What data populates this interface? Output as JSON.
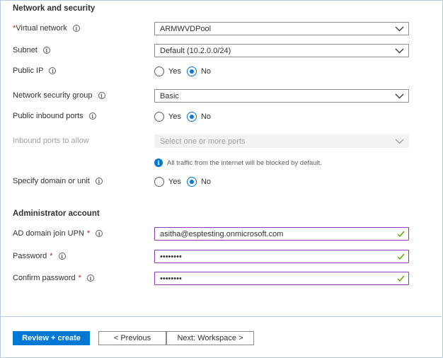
{
  "network_section": {
    "title": "Network and security",
    "virtual_network": {
      "required_mark": "*",
      "label": "Virtual network",
      "value": "ARMWVDPool"
    },
    "subnet": {
      "label": "Subnet",
      "value": "Default (10.2.0.0/24)"
    },
    "public_ip": {
      "label": "Public IP",
      "options": [
        "Yes",
        "No"
      ],
      "selected": "No"
    },
    "nsg": {
      "label": "Network security group",
      "value": "Basic"
    },
    "public_inbound_ports": {
      "label": "Public inbound ports",
      "options": [
        "Yes",
        "No"
      ],
      "selected": "No"
    },
    "inbound_ports": {
      "label": "Inbound ports to allow",
      "placeholder": "Select one or more ports"
    },
    "traffic_note": "All traffic from the internet will be blocked by default.",
    "specify_domain": {
      "label": "Specify domain or unit",
      "options": [
        "Yes",
        "No"
      ],
      "selected": "No"
    }
  },
  "admin_section": {
    "title": "Administrator account",
    "upn": {
      "label": "AD domain join UPN",
      "required_mark": "*",
      "value": "asitha@esptesting.onmicrosoft.com"
    },
    "password": {
      "label": "Password",
      "required_mark": "*",
      "value": "••••••••"
    },
    "confirm_password": {
      "label": "Confirm password",
      "required_mark": "*",
      "value": "••••••••"
    }
  },
  "footer": {
    "review_create": "Review + create",
    "previous": "< Previous",
    "next": "Next: Workspace >"
  },
  "colors": {
    "primary": "#0078d4",
    "required": "#a4262c",
    "valid_border": "#8c3cbf",
    "valid_check": "#57a300"
  },
  "icons": {
    "info": "info-icon",
    "chevron": "chevron-down-icon",
    "check": "checkmark-icon"
  }
}
